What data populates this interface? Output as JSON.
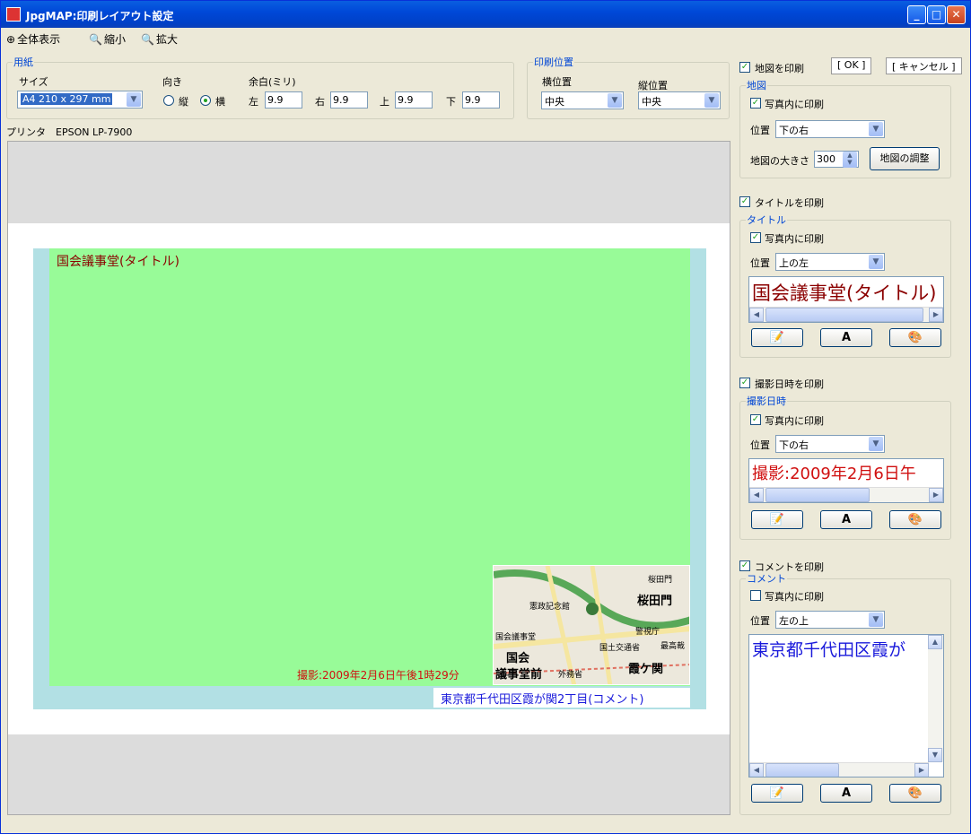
{
  "window": {
    "title": "JpgMAP:印刷レイアウト設定"
  },
  "toolbar": {
    "fit": "全体表示",
    "zoom_out": "縮小",
    "zoom_in": "拡大",
    "ok": "[ OK ]",
    "cancel": "[ キャンセル ]"
  },
  "paper": {
    "legend": "用紙",
    "size_label": "サイズ",
    "size_value": "A4 210 x 297 mm",
    "orient_label": "向き",
    "portrait": "縦",
    "landscape": "横",
    "margin_label": "余白(ミリ)",
    "left": "左",
    "left_value": "9.9",
    "right": "右",
    "right_value": "9.9",
    "top": "上",
    "top_value": "9.9",
    "bottom": "下",
    "bottom_value": "9.9"
  },
  "print_pos": {
    "legend": "印刷位置",
    "h_label": "横位置",
    "h_value": "中央",
    "v_label": "縦位置",
    "v_value": "中央"
  },
  "printer": "プリンタ　EPSON LP-7900",
  "preview": {
    "title_text": "国会議事堂(タイトル)",
    "date_text": "撮影:2009年2月6日午後1時29分",
    "comment_text": "東京都千代田区霞が関2丁目(コメント)",
    "map_labels": [
      "桜田門",
      "憲政記念館",
      "桜田門",
      "警視庁",
      "国会議事堂",
      "国土交通省",
      "最高裁",
      "国会",
      "議事堂前",
      "外務省",
      "霞ケ関"
    ]
  },
  "map_section": {
    "print_chk": "地図を印刷",
    "legend": "地図",
    "inside_chk": "写真内に印刷",
    "pos_label": "位置",
    "pos_value": "下の右",
    "size_label": "地図の大きさ",
    "size_value": "300",
    "adjust_btn": "地図の調整"
  },
  "title_section": {
    "print_chk": "タイトルを印刷",
    "legend": "タイトル",
    "inside_chk": "写真内に印刷",
    "pos_label": "位置",
    "pos_value": "上の左",
    "sample": "国会議事堂(タイトル)"
  },
  "date_section": {
    "print_chk": "撮影日時を印刷",
    "legend": "撮影日時",
    "inside_chk": "写真内に印刷",
    "pos_label": "位置",
    "pos_value": "下の右",
    "sample": "撮影:2009年2月6日午"
  },
  "comment_section": {
    "print_chk": "コメントを印刷",
    "legend": "コメント",
    "inside_chk": "写真内に印刷",
    "pos_label": "位置",
    "pos_value": "左の上",
    "sample": "東京都千代田区霞が"
  },
  "font_btn": "A",
  "colors": {
    "title": "#8b0000",
    "date": "#d01010",
    "comment": "#1a1adb",
    "photo": "#98fb98",
    "photo_bg": "#b2e0e4"
  }
}
